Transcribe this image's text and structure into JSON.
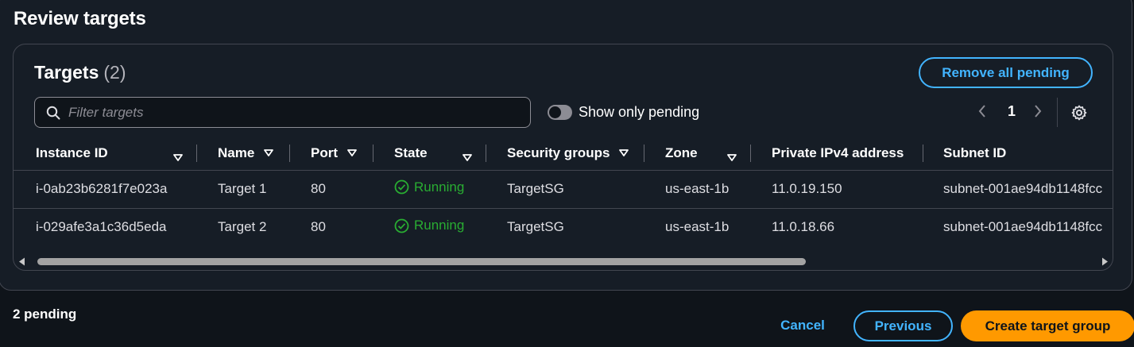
{
  "section": {
    "title": "Review targets"
  },
  "targets": {
    "title": "Targets",
    "count": "(2)",
    "remove_all_label": "Remove all pending",
    "filter_placeholder": "Filter targets",
    "toggle_label": "Show only pending",
    "toggle_on": false,
    "page": "1",
    "columns": [
      "Instance ID",
      "Name",
      "Port",
      "State",
      "Security groups",
      "Zone",
      "Private IPv4 address",
      "Subnet ID"
    ],
    "rows": [
      {
        "instance_id": "i-0ab23b6281f7e023a",
        "name": "Target 1",
        "port": "80",
        "state": "Running",
        "security_group": "TargetSG",
        "zone": "us-east-1b",
        "ip": "11.0.19.150",
        "subnet": "subnet-001ae94db1148fcc"
      },
      {
        "instance_id": "i-029afe3a1c36d5eda",
        "name": "Target 2",
        "port": "80",
        "state": "Running",
        "security_group": "TargetSG",
        "zone": "us-east-1b",
        "ip": "11.0.18.66",
        "subnet": "subnet-001ae94db1148fcc"
      }
    ],
    "horizontal_scroll_fraction": 0.73
  },
  "footer": {
    "pending": "2 pending",
    "cancel_label": "Cancel",
    "previous_label": "Previous",
    "create_label": "Create target group"
  },
  "colors": {
    "accent": "#42b4ff",
    "primary": "#ff9900",
    "running": "#29ad32",
    "background": "#0f141a",
    "panel": "#161d26"
  }
}
